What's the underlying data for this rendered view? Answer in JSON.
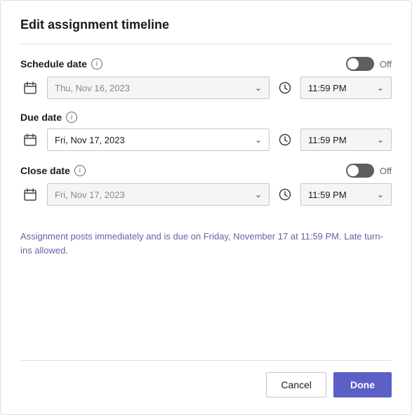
{
  "dialog": {
    "title": "Edit assignment timeline",
    "divider": true
  },
  "schedule_date": {
    "label": "Schedule date",
    "toggle_state": "off",
    "toggle_label": "Off",
    "date_value": "Thu, Nov 16, 2023",
    "date_placeholder": "Thu, Nov 16, 2023",
    "date_active": false,
    "time_value": "11:59 PM"
  },
  "due_date": {
    "label": "Due date",
    "date_value": "Fri, Nov 17, 2023",
    "date_active": true,
    "time_value": "11:59 PM"
  },
  "close_date": {
    "label": "Close date",
    "toggle_state": "off",
    "toggle_label": "Off",
    "date_value": "Fri, Nov 17, 2023",
    "date_placeholder": "Fri, Nov 17, 2023",
    "date_active": false,
    "time_value": "11:59 PM"
  },
  "info_text": "Assignment posts immediately and is due on Friday, November 17 at 11:59 PM. Late turn-ins allowed.",
  "footer": {
    "cancel_label": "Cancel",
    "done_label": "Done"
  }
}
